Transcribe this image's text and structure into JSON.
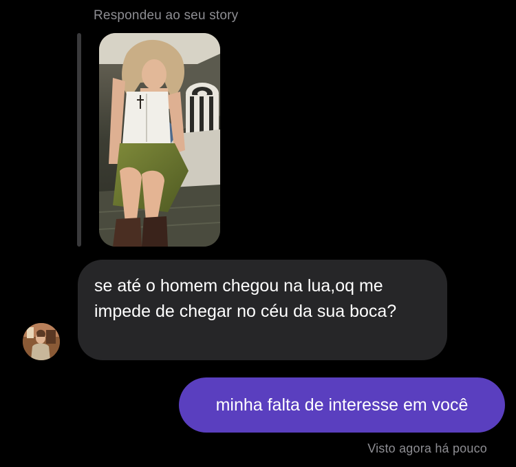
{
  "conversation": {
    "story_reply_caption": "Respondeu ao seu story",
    "story_thumbnail": "story-photo",
    "incoming_message": "se até o homem chegou na lua,oq me impede de chegar no céu da sua boca?",
    "outgoing_message": "minha falta de interesse em você",
    "seen_status": "Visto agora há pouco",
    "sender_avatar": "profile-photo"
  },
  "colors": {
    "background": "#000000",
    "incoming_bubble": "#262628",
    "outgoing_bubble": "#5a3fbf",
    "muted_text": "#8e8e93",
    "reply_bar": "#3a3a3c"
  }
}
